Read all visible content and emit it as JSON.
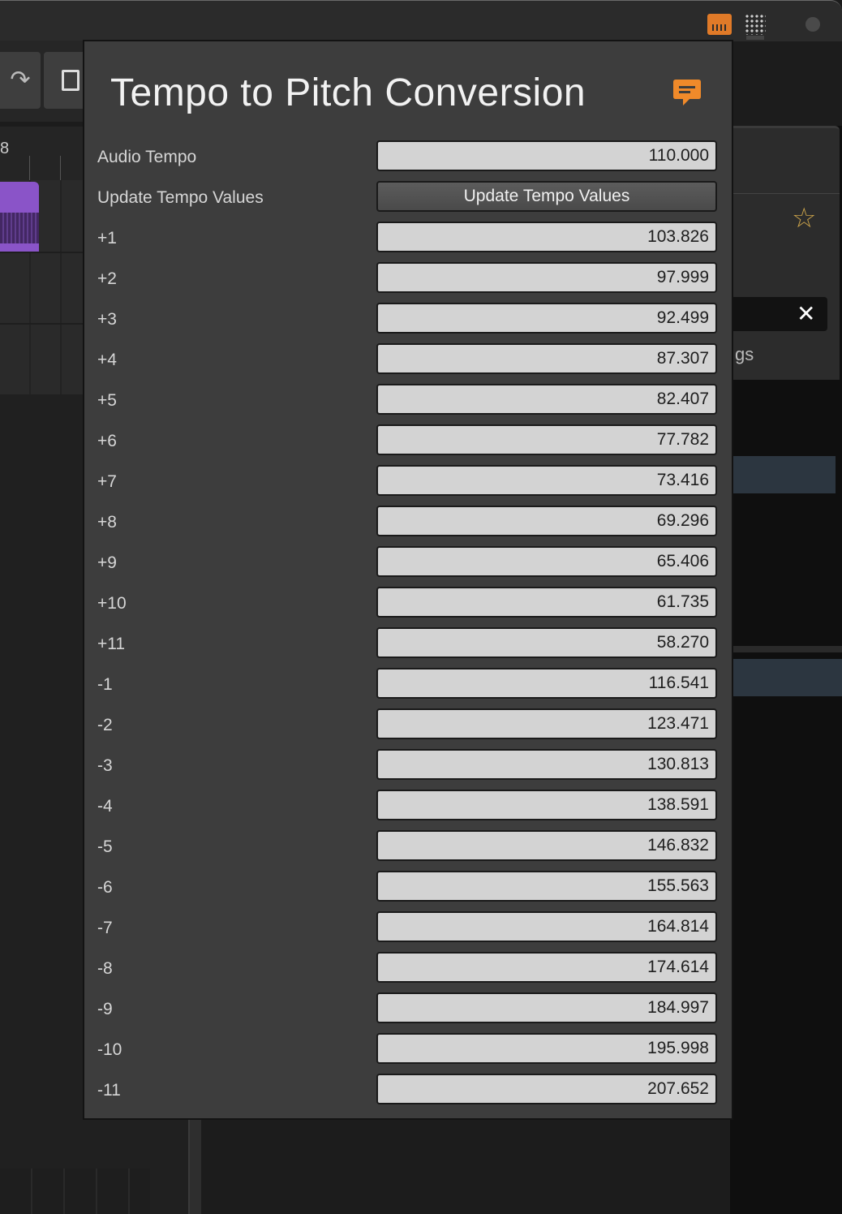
{
  "dialog": {
    "title": "Tempo to Pitch Conversion",
    "feedback_icon": "speech-bubble-icon",
    "accent_color": "#f08a2a"
  },
  "audio_tempo": {
    "label": "Audio Tempo",
    "value": "110.000"
  },
  "update": {
    "label": "Update Tempo Values",
    "button_label": "Update Tempo Values"
  },
  "pitch_rows": [
    {
      "label": "+1",
      "value": "103.826"
    },
    {
      "label": "+2",
      "value": "97.999"
    },
    {
      "label": "+3",
      "value": "92.499"
    },
    {
      "label": "+4",
      "value": "87.307"
    },
    {
      "label": "+5",
      "value": "82.407"
    },
    {
      "label": "+6",
      "value": "77.782"
    },
    {
      "label": "+7",
      "value": "73.416"
    },
    {
      "label": "+8",
      "value": "69.296"
    },
    {
      "label": "+9",
      "value": "65.406"
    },
    {
      "label": "+10",
      "value": "61.735"
    },
    {
      "label": "+11",
      "value": "58.270"
    },
    {
      "label": "-1",
      "value": "116.541"
    },
    {
      "label": "-2",
      "value": "123.471"
    },
    {
      "label": "-3",
      "value": "130.813"
    },
    {
      "label": "-4",
      "value": "138.591"
    },
    {
      "label": "-5",
      "value": "146.832"
    },
    {
      "label": "-6",
      "value": "155.563"
    },
    {
      "label": "-7",
      "value": "164.814"
    },
    {
      "label": "-8",
      "value": "174.614"
    },
    {
      "label": "-9",
      "value": "184.997"
    },
    {
      "label": "-10",
      "value": "195.998"
    },
    {
      "label": "-11",
      "value": "207.652"
    }
  ],
  "background": {
    "ruler_number": "8",
    "partial_label": "gs",
    "icons": [
      "piano-keyboard-icon",
      "grid-icon",
      "redo-icon",
      "new-clip-icon",
      "star-icon",
      "close-icon"
    ],
    "clip_color": "#8a54c8"
  }
}
